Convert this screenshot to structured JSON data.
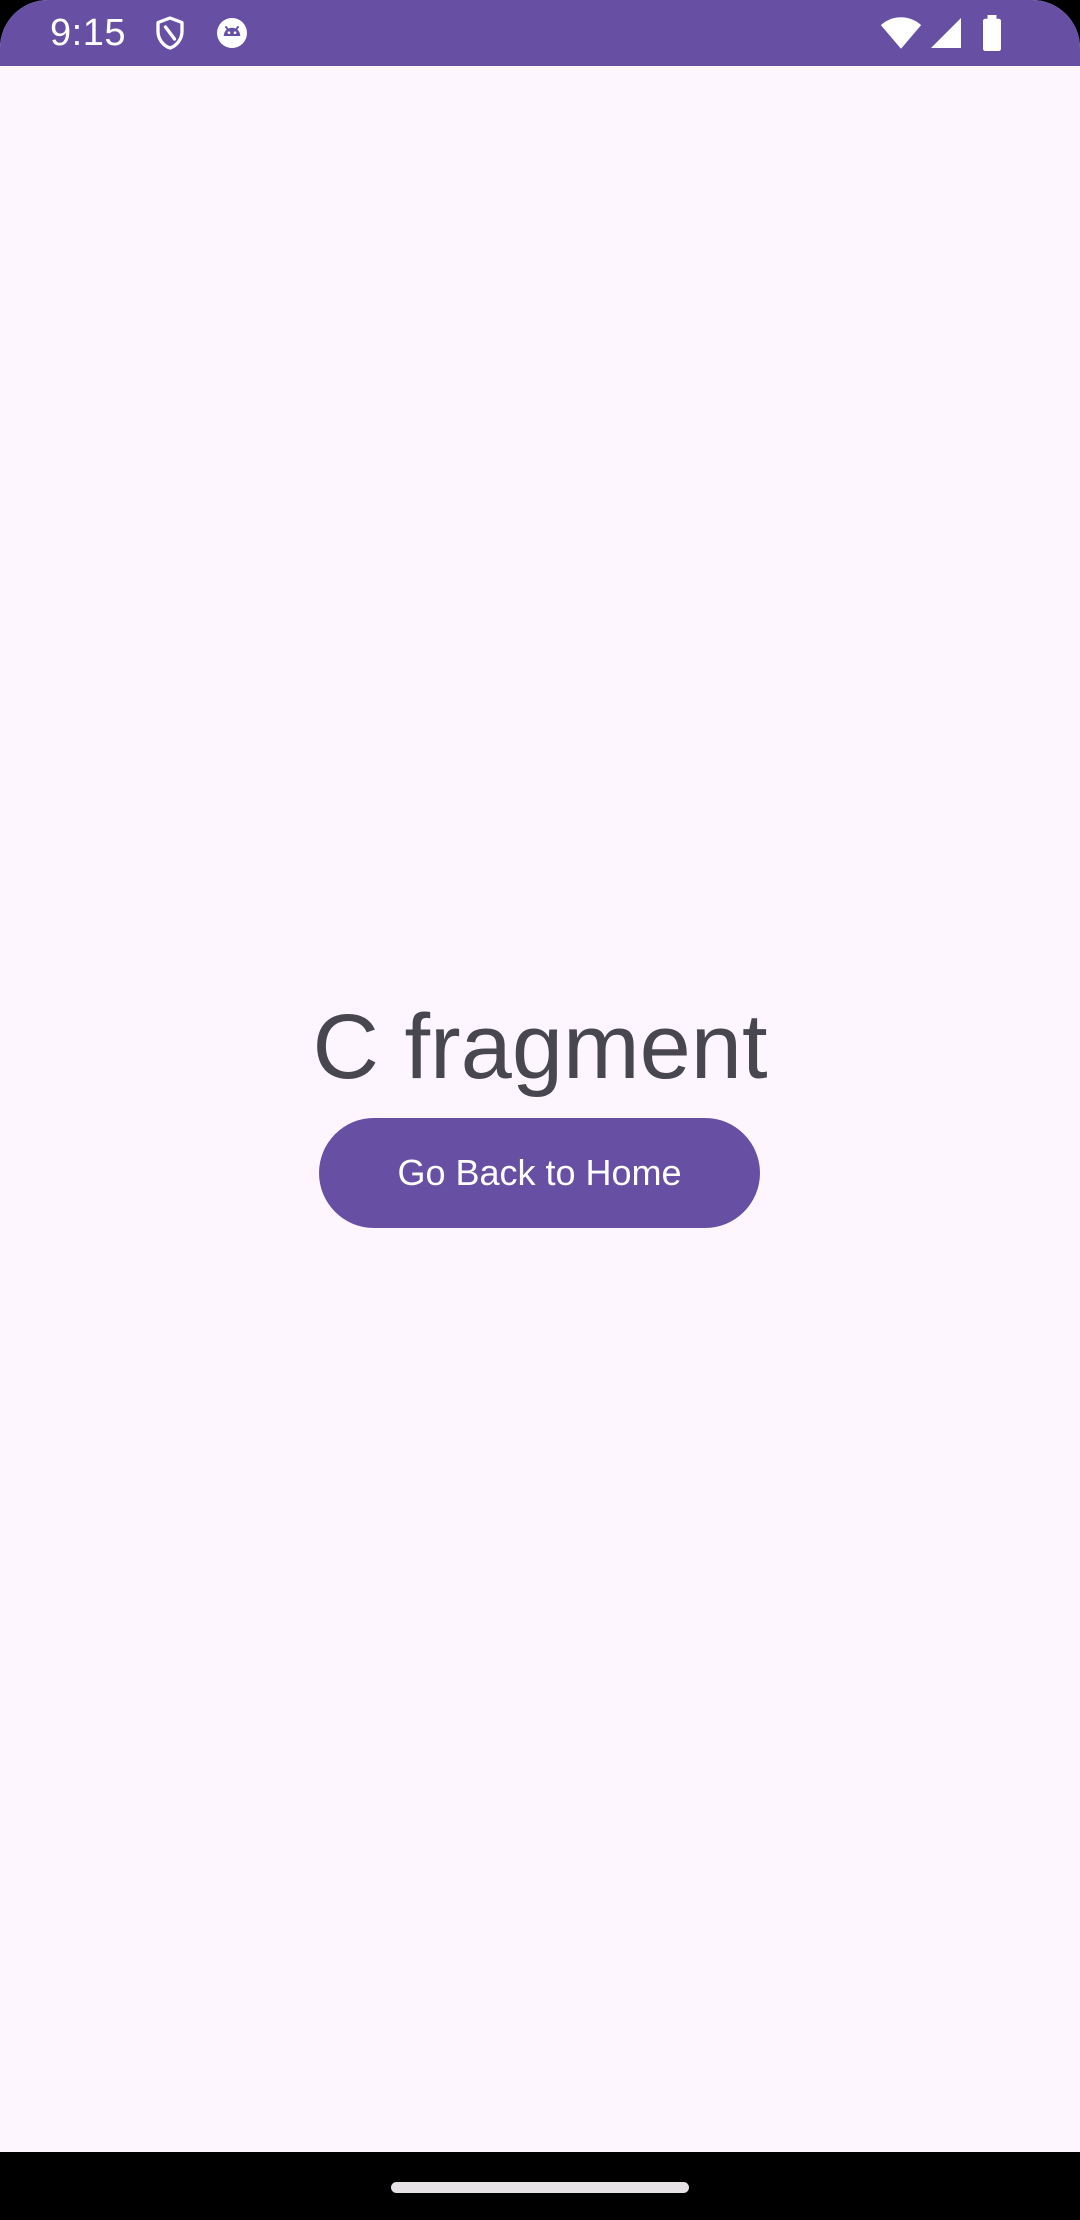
{
  "status_bar": {
    "time": "9:15",
    "background_color": "#6750a4",
    "icons": [
      "shield-icon",
      "android-bot-icon",
      "wifi-icon",
      "signal-icon",
      "battery-icon"
    ]
  },
  "main": {
    "title": "C fragment",
    "button_label": "Go Back to Home",
    "background_color": "#fdf6fe",
    "accent_color": "#6750a4",
    "text_color": "#48464e"
  },
  "nav_bar": {
    "icons": [
      "home-indicator"
    ]
  }
}
